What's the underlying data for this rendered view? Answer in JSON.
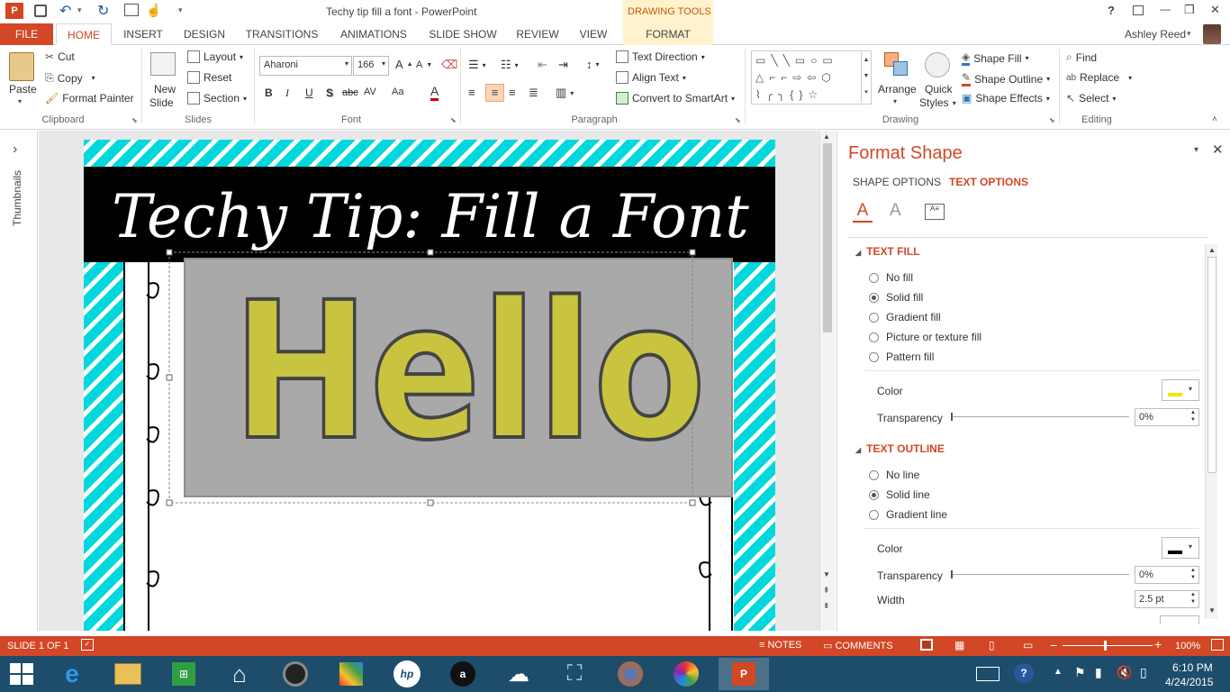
{
  "window": {
    "title": "Techy tip fill a font - PowerPoint",
    "context_tab_group": "DRAWING TOOLS",
    "user": "Ashley Reed",
    "controls": {
      "help": "?",
      "minimize": "—",
      "restore": "❐",
      "close": "✕"
    }
  },
  "tabs": [
    "FILE",
    "HOME",
    "INSERT",
    "DESIGN",
    "TRANSITIONS",
    "ANIMATIONS",
    "SLIDE SHOW",
    "REVIEW",
    "VIEW",
    "FORMAT"
  ],
  "active_tab": "HOME",
  "ribbon": {
    "clipboard": {
      "paste": "Paste",
      "cut": "Cut",
      "copy": "Copy",
      "format_painter": "Format Painter",
      "label": "Clipboard"
    },
    "slides": {
      "new_slide_1": "New",
      "new_slide_2": "Slide",
      "layout": "Layout",
      "reset": "Reset",
      "section": "Section",
      "label": "Slides"
    },
    "font": {
      "family": "Aharoni",
      "size": "166",
      "label": "Font",
      "bold": "B",
      "italic": "I",
      "underline": "U",
      "shadow": "S",
      "strike": "abc",
      "spacing": "AV",
      "case": "Aa",
      "color": "A"
    },
    "paragraph": {
      "text_direction": "Text Direction",
      "align_text": "Align Text",
      "convert_smartart": "Convert to SmartArt",
      "label": "Paragraph"
    },
    "drawing": {
      "arrange": "Arrange",
      "quick_styles_1": "Quick",
      "quick_styles_2": "Styles",
      "shape_fill": "Shape Fill",
      "shape_outline": "Shape Outline",
      "shape_effects": "Shape Effects",
      "label": "Drawing"
    },
    "editing": {
      "find": "Find",
      "replace": "Replace",
      "select": "Select",
      "label": "Editing"
    }
  },
  "left_panel": {
    "label": "Thumbnails",
    "expand": "›"
  },
  "slide": {
    "title": "Techy Tip: Fill a Font",
    "body_text": "Hello",
    "colors": {
      "teal": "#00d4d8",
      "black_band": "#000000",
      "text_fill": "#c8c440",
      "text_outline": "#444444",
      "box_fill": "#a9a9a9"
    }
  },
  "format_pane": {
    "title": "Format Shape",
    "tabs": [
      "SHAPE OPTIONS",
      "TEXT OPTIONS"
    ],
    "active_tab": "TEXT OPTIONS",
    "text_fill": {
      "heading": "TEXT FILL",
      "options": [
        "No fill",
        "Solid fill",
        "Gradient fill",
        "Picture or texture fill",
        "Pattern fill"
      ],
      "selected": "Solid fill",
      "color_label": "Color",
      "transparency_label": "Transparency",
      "transparency_value": "0%",
      "color_swatch": "#f5e600"
    },
    "text_outline": {
      "heading": "TEXT OUTLINE",
      "options": [
        "No line",
        "Solid line",
        "Gradient line"
      ],
      "selected": "Solid line",
      "color_label": "Color",
      "transparency_label": "Transparency",
      "transparency_value": "0%",
      "width_label": "Width",
      "width_value": "2.5 pt",
      "color_swatch": "#000000"
    }
  },
  "status": {
    "slide": "SLIDE 1 OF 1",
    "notes": "NOTES",
    "comments": "COMMENTS",
    "zoom": "100%"
  },
  "taskbar": {
    "time": "6:10 PM",
    "date": "4/24/2015",
    "apps": [
      "windows-start",
      "internet-explorer",
      "file-explorer",
      "store",
      "home",
      "media",
      "photos",
      "hp",
      "amazon",
      "weather",
      "cloud",
      "firefox",
      "picasa",
      "powerpoint"
    ]
  }
}
